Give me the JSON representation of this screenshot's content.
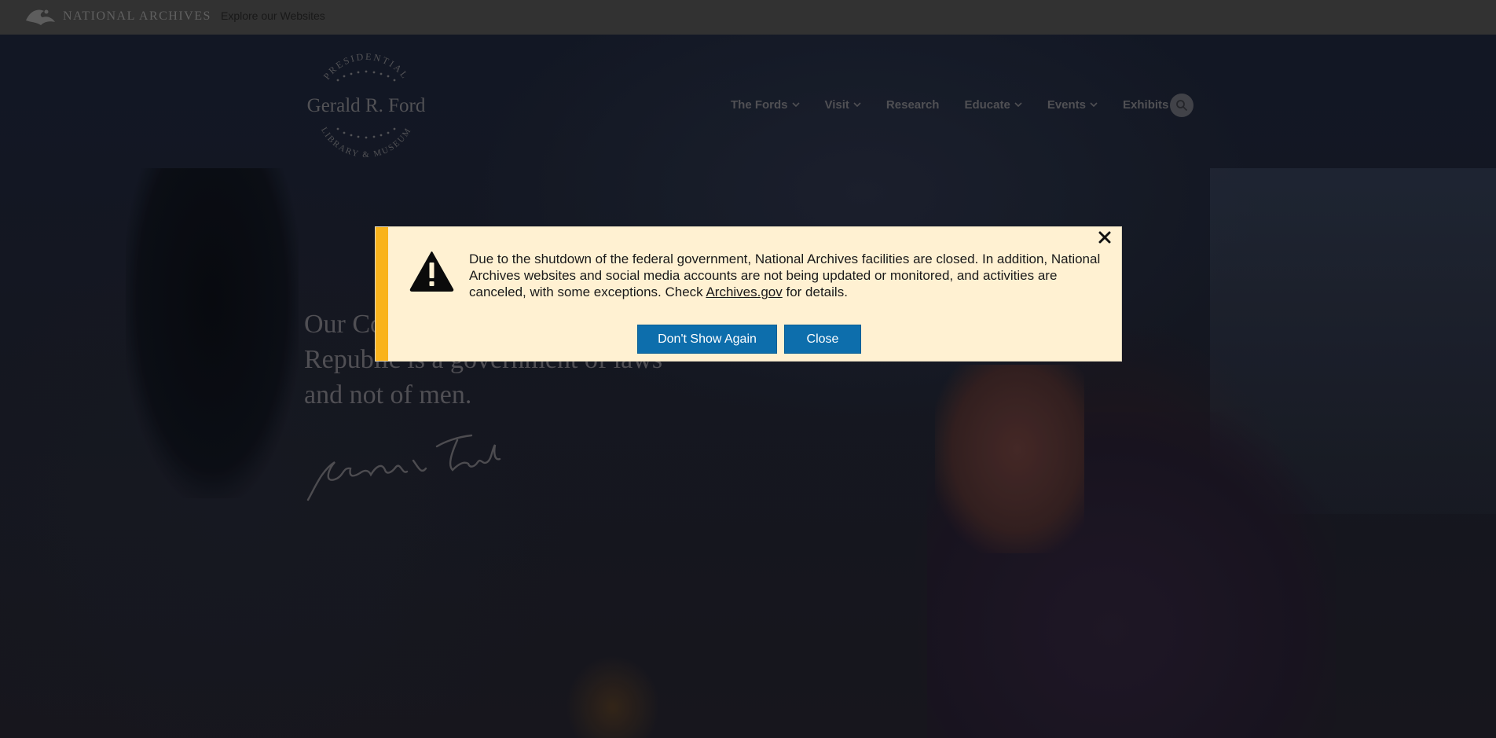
{
  "topbar": {
    "logo_text": "NATIONAL ARCHIVES",
    "explore_link": "Explore our Websites"
  },
  "header": {
    "logo": {
      "top_arc": "PRESIDENTIAL",
      "name": "Gerald R. Ford",
      "bottom_arc": "LIBRARY & MUSEUM"
    },
    "nav": [
      {
        "label": "The Fords",
        "has_dropdown": true
      },
      {
        "label": "Visit",
        "has_dropdown": true
      },
      {
        "label": "Research",
        "has_dropdown": false
      },
      {
        "label": "Educate",
        "has_dropdown": true
      },
      {
        "label": "Events",
        "has_dropdown": true
      },
      {
        "label": "Exhibits",
        "has_dropdown": false
      }
    ],
    "search_icon": "search-icon"
  },
  "hero": {
    "quote_line1": "Our Constitution works; our great",
    "quote_line2": "Republic is a government of laws",
    "quote_line3": "and not of men.",
    "signature": "Gerald R. Ford"
  },
  "alert": {
    "icon": "warning-icon",
    "message_before_link": "Due to the shutdown of the federal government, National Archives facilities are closed. In addition, National Archives websites and social media accounts are not being updated or monitored, and activities are canceled, with some exceptions. Check ",
    "link_text": "Archives.gov",
    "message_after_link": " for details.",
    "dont_show_label": "Don't Show Again",
    "close_label": "Close",
    "close_icon": "close-icon"
  },
  "colors": {
    "alert_background": "#fff1d2",
    "alert_stripe": "#f9b31c",
    "button_blue": "#0d6eac"
  }
}
